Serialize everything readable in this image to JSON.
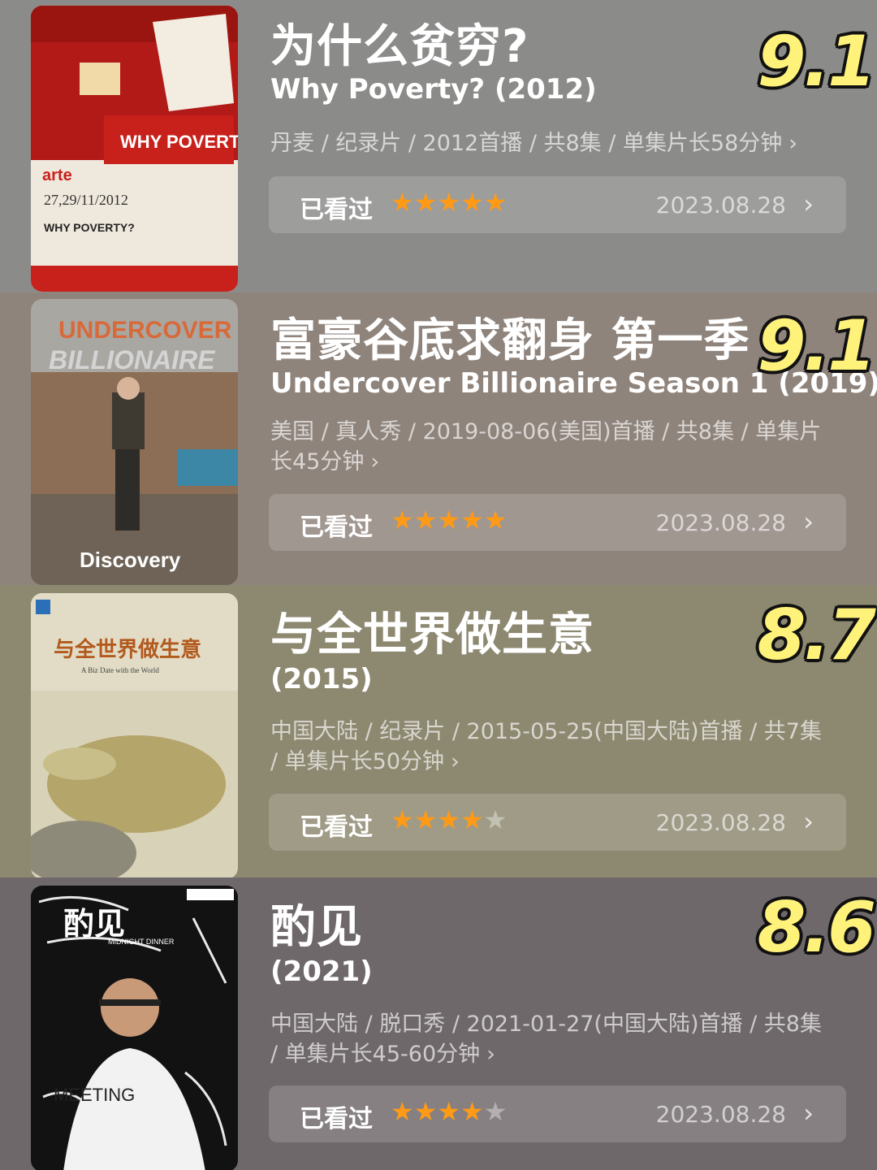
{
  "items": [
    {
      "title": "为什么贫穷?",
      "subtitle": "Why Poverty? (2012)",
      "meta": "丹麦 / 纪录片 / 2012首播 / 共8集 / 单集片长58分钟",
      "score": "9.1",
      "watched_label": "已看过",
      "rating_stars": 5,
      "date": "2023.08.28",
      "bg_color": "#8b8b89",
      "poster_text": [
        "WHY POVERTY?",
        "arte",
        "27,29/11/2012",
        "WHY POVERTY?"
      ]
    },
    {
      "title": "富豪谷底求翻身 第一季",
      "subtitle": "Undercover Billionaire Season 1 (2019)",
      "meta": "美国 / 真人秀 / 2019-08-06(美国)首播 / 共8集 / 单集片长45分钟",
      "score": "9.1",
      "watched_label": "已看过",
      "rating_stars": 5,
      "date": "2023.08.28",
      "bg_color": "#8f847c",
      "poster_text": [
        "UNDERCOVER",
        "BILLIONAIRE",
        "Discovery"
      ]
    },
    {
      "title": "与全世界做生意",
      "subtitle": "(2015)",
      "meta": "中国大陆 / 纪录片 / 2015-05-25(中国大陆)首播 / 共7集 / 单集片长50分钟",
      "score": "8.7",
      "watched_label": "已看过",
      "rating_stars": 4,
      "date": "2023.08.28",
      "bg_color": "#8d8870",
      "poster_text": [
        "与全世界做生意",
        "A Biz Date with the World"
      ]
    },
    {
      "title": "酌见",
      "subtitle": "(2021)",
      "meta": "中国大陆 / 脱口秀 / 2021-01-27(中国大陆)首播 / 共8集 / 单集片长45-60分钟",
      "score": "8.6",
      "watched_label": "已看过",
      "rating_stars": 4,
      "date": "2023.08.28",
      "bg_color": "#6f686b",
      "poster_text": [
        "酌见",
        "MIDNIGHT DINNER",
        "MEETING"
      ]
    }
  ],
  "icons": {
    "meta_chevron": "chevron-right-icon",
    "row_chevron": "chevron-right-icon",
    "star": "star-icon"
  },
  "colors": {
    "score_fill": "#fff27a",
    "star_on": "#ff9a16"
  }
}
